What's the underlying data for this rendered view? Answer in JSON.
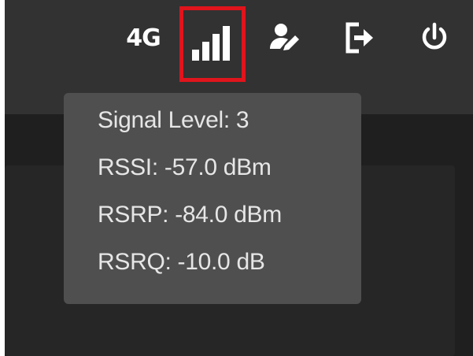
{
  "header": {
    "network_type": "4G",
    "icons": {
      "signal": "signal-bars-icon",
      "user_edit": "user-edit-icon",
      "logout": "logout-icon",
      "power": "power-icon"
    },
    "highlight_color": "#e0141c"
  },
  "signal": {
    "bars_filled": 3,
    "bars_total": 4
  },
  "tooltip": {
    "signal_level": "Signal Level: 3",
    "rssi": "RSSI: -57.0 dBm",
    "rsrp": "RSRP: -84.0 dBm",
    "rsrq": "RSRQ: -10.0 dB"
  },
  "colors": {
    "topbar": "#323232",
    "background": "#1f1f1f",
    "tooltip_bg": "#4f4f4f",
    "text": "#e6e6e6"
  }
}
